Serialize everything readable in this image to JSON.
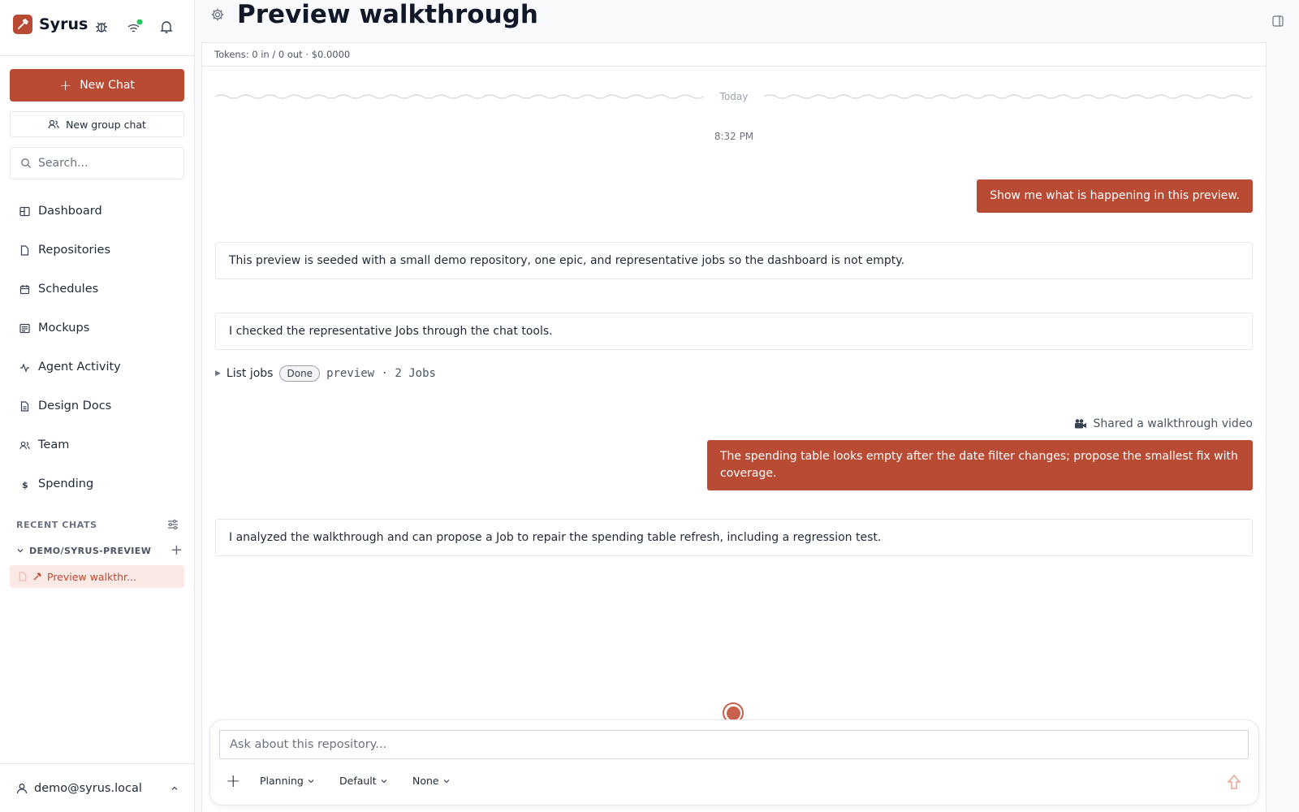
{
  "app": {
    "name": "Syrus"
  },
  "sidebar": {
    "new_chat_label": "New Chat",
    "new_group_label": "New group chat",
    "search_placeholder": "Search...",
    "nav": [
      {
        "label": "Dashboard",
        "icon": "dashboard-icon"
      },
      {
        "label": "Repositories",
        "icon": "file-icon"
      },
      {
        "label": "Schedules",
        "icon": "calendar-icon"
      },
      {
        "label": "Mockups",
        "icon": "layout-icon"
      },
      {
        "label": "Agent Activity",
        "icon": "activity-icon"
      },
      {
        "label": "Design Docs",
        "icon": "document-icon"
      },
      {
        "label": "Team",
        "icon": "users-icon"
      },
      {
        "label": "Spending",
        "icon": "dollar-icon"
      }
    ],
    "recent_title": "RECENT CHATS",
    "repo_name": "DEMO/SYRUS-PREVIEW",
    "active_chat": "Preview walkthr...",
    "user_email": "demo@syrus.local"
  },
  "header": {
    "title": "Preview walkthrough"
  },
  "chat": {
    "tokens": "Tokens: 0 in / 0 out · $0.0000",
    "day_divider": "Today",
    "timestamp": "8:32 PM",
    "messages": {
      "user_1": "Show me what is happening in this preview.",
      "bot_1": "This preview is seeded with a small demo repository, one epic, and representative jobs so the dashboard is not empty.",
      "bot_2": "I checked the representative Jobs through the chat tools.",
      "tool_name": "List jobs",
      "tool_status": "Done",
      "tool_detail": "preview · 2 Jobs",
      "shared_label": "Shared a walkthrough video",
      "user_2": "The spending table looks empty after the date filter changes; propose the smallest fix with coverage.",
      "bot_3": "I analyzed the walkthrough and can propose a Job to repair the spending table refresh, including a regression test."
    }
  },
  "composer": {
    "placeholder": "Ask about this repository...",
    "mode": "Planning",
    "model": "Default",
    "reasoning": "None"
  },
  "colors": {
    "accent": "#b94a33",
    "accent_light": "#fbe9e6",
    "status_online": "#22c55e"
  }
}
